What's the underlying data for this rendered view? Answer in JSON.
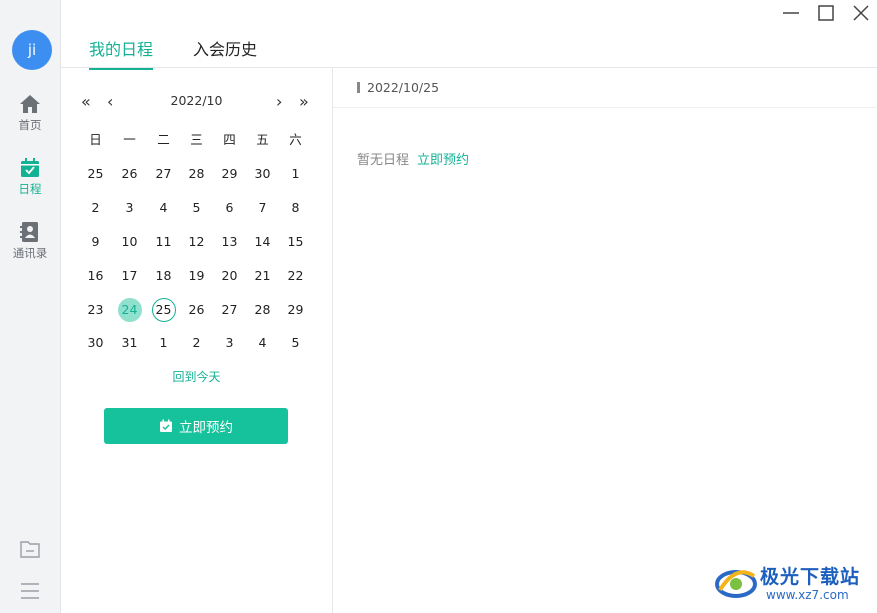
{
  "sidebar": {
    "avatar_text": "ji",
    "items": [
      {
        "label": "首页",
        "icon": "home-icon"
      },
      {
        "label": "日程",
        "icon": "calendar-icon"
      },
      {
        "label": "通讯录",
        "icon": "contacts-icon"
      }
    ],
    "bottom_icons": [
      "folder-icon",
      "menu-icon"
    ]
  },
  "window_controls": [
    "minimize-icon",
    "maximize-icon",
    "close-icon"
  ],
  "tabs": [
    {
      "label": "我的日程"
    },
    {
      "label": "入会历史"
    }
  ],
  "calendar": {
    "month_label": "2022/10",
    "weekdays": [
      "日",
      "一",
      "二",
      "三",
      "四",
      "五",
      "六"
    ],
    "weeks": [
      [
        "25",
        "26",
        "27",
        "28",
        "29",
        "30",
        "1"
      ],
      [
        "2",
        "3",
        "4",
        "5",
        "6",
        "7",
        "8"
      ],
      [
        "9",
        "10",
        "11",
        "12",
        "13",
        "14",
        "15"
      ],
      [
        "16",
        "17",
        "18",
        "19",
        "20",
        "21",
        "22"
      ],
      [
        "23",
        "24",
        "25",
        "26",
        "27",
        "28",
        "29"
      ],
      [
        "30",
        "31",
        "1",
        "2",
        "3",
        "4",
        "5"
      ]
    ],
    "selected_day": "24",
    "today_day": "25",
    "back_today_label": "回到今天",
    "book_button_label": "立即预约",
    "nav": {
      "prev_year": "«",
      "prev_month": "‹",
      "next_month": "›",
      "next_year": "»"
    }
  },
  "detail": {
    "date_label": "2022/10/25",
    "empty_text": "暂无日程",
    "empty_link": "立即预约"
  },
  "watermark": {
    "text": "极光下载站",
    "url": "www.xz7.com"
  },
  "colors": {
    "accent": "#13b294",
    "button": "#16c29b",
    "avatar": "#3c8ef0",
    "selected_fill": "#8fe0cd"
  }
}
